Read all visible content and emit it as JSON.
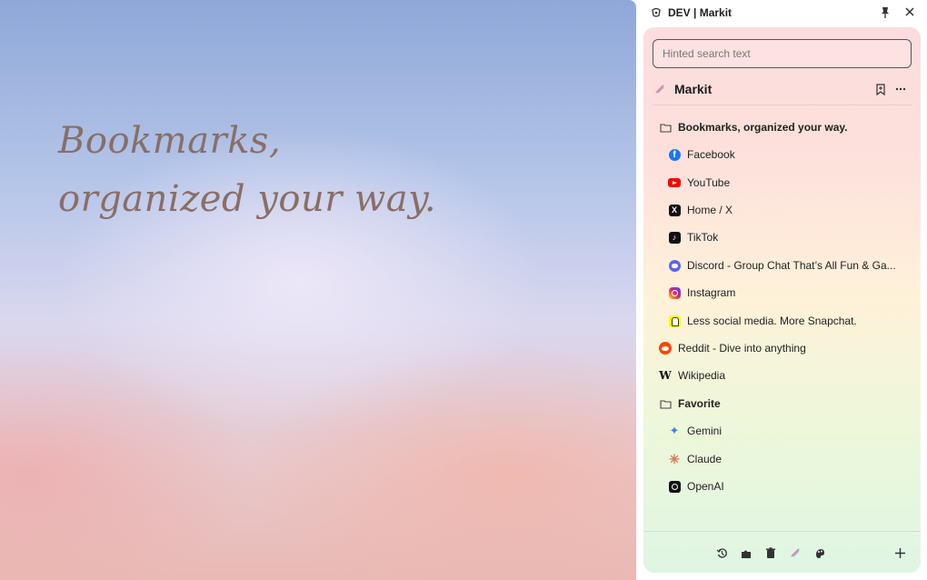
{
  "hero": {
    "line1": "Bookmarks,",
    "line2": "organized your way."
  },
  "window": {
    "title": "DEV | Markit"
  },
  "search": {
    "placeholder": "Hinted search text",
    "value": ""
  },
  "header": {
    "name": "Markit"
  },
  "tree": [
    {
      "label": "Bookmarks, organized your way.",
      "type": "folder",
      "level": 0,
      "icon": "folder-icon"
    },
    {
      "label": "Facebook",
      "type": "bookmark",
      "level": 1,
      "icon": "facebook-icon"
    },
    {
      "label": "YouTube",
      "type": "bookmark",
      "level": 1,
      "icon": "youtube-icon"
    },
    {
      "label": "Home / X",
      "type": "bookmark",
      "level": 1,
      "icon": "x-icon"
    },
    {
      "label": "TikTok",
      "type": "bookmark",
      "level": 1,
      "icon": "tiktok-icon"
    },
    {
      "label": "Discord - Group Chat That’s All Fun & Ga...",
      "type": "bookmark",
      "level": 1,
      "icon": "discord-icon"
    },
    {
      "label": "Instagram",
      "type": "bookmark",
      "level": 1,
      "icon": "instagram-icon"
    },
    {
      "label": "Less social media. More Snapchat.",
      "type": "bookmark",
      "level": 1,
      "icon": "snapchat-icon"
    },
    {
      "label": "Reddit - Dive into anything",
      "type": "bookmark",
      "level": 0,
      "icon": "reddit-icon"
    },
    {
      "label": "Wikipedia",
      "type": "bookmark",
      "level": 0,
      "icon": "wikipedia-icon"
    },
    {
      "label": "Favorite",
      "type": "folder",
      "level": 0,
      "icon": "folder-icon"
    },
    {
      "label": "Gemini",
      "type": "bookmark",
      "level": 1,
      "icon": "gemini-icon"
    },
    {
      "label": "Claude",
      "type": "bookmark",
      "level": 1,
      "icon": "claude-icon"
    },
    {
      "label": "OpenAI",
      "type": "bookmark",
      "level": 1,
      "icon": "openai-icon"
    }
  ],
  "footer": {
    "buttons": [
      "history-icon",
      "extensions-icon",
      "trash-icon",
      "markit-icon",
      "theme-icon",
      "add-icon"
    ]
  },
  "colors": {
    "hero_text": "#8a6e66",
    "card_top": "#fcdcdc",
    "card_bottom": "#dff6e4"
  }
}
